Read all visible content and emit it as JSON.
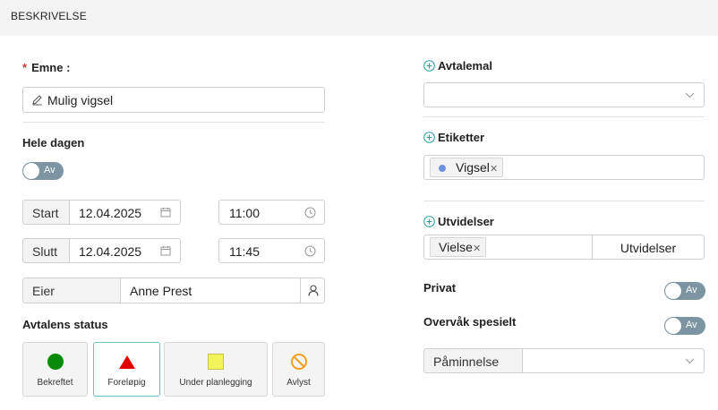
{
  "header": {
    "title": "BESKRIVELSE"
  },
  "left": {
    "subject": {
      "required_mark": "*",
      "label": "Emne :",
      "value": "Mulig vigsel",
      "icon": "pencil-icon"
    },
    "allday": {
      "label": "Hele dagen",
      "toggle_text": "Av"
    },
    "start": {
      "label": "Start",
      "date": "12.04.2025",
      "time": "11:00"
    },
    "end": {
      "label": "Slutt",
      "date": "12.04.2025",
      "time": "11:45"
    },
    "owner": {
      "label": "Eier",
      "value": "Anne Prest"
    },
    "status": {
      "label": "Avtalens status",
      "options": [
        {
          "label": "Bekreftet",
          "color": "#0a8a0a",
          "shape": "circle"
        },
        {
          "label": "Foreløpig",
          "color": "#e00000",
          "shape": "triangle",
          "selected": true
        },
        {
          "label": "Under planlegging",
          "color": "#f3f35a",
          "shape": "square"
        },
        {
          "label": "Avlyst",
          "color": "#f0a020",
          "shape": "cancel"
        }
      ]
    }
  },
  "right": {
    "template": {
      "label": "Avtalemal",
      "value": ""
    },
    "tags": {
      "label": "Etiketter",
      "items": [
        {
          "text": "Vigsel",
          "dot_color": "#6f93e0"
        }
      ]
    },
    "extensions": {
      "label": "Utvidelser",
      "items": [
        {
          "text": "Vielse"
        }
      ],
      "button_label": "Utvidelser"
    },
    "private": {
      "label": "Privat",
      "toggle_text": "Av"
    },
    "monitor": {
      "label": "Overvåk spesielt",
      "toggle_text": "Av"
    },
    "reminder": {
      "label": "Påminnelse",
      "value": ""
    }
  },
  "colors": {
    "accent": "#2a9d9d",
    "toggle_off": "#7d95a3",
    "border": "#cfcfcf"
  }
}
